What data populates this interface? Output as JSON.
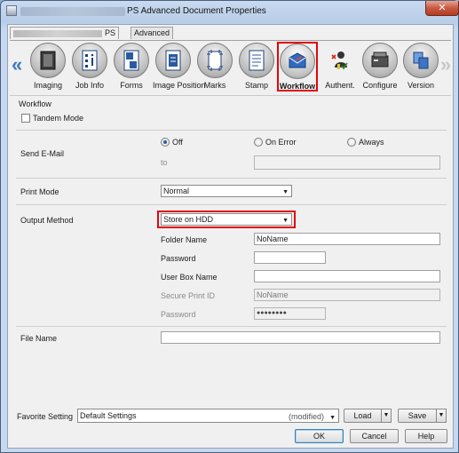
{
  "window": {
    "title": "PS Advanced Document Properties",
    "close_glyph": "✕"
  },
  "tabs": [
    {
      "label": "PS"
    },
    {
      "label": "Advanced"
    }
  ],
  "nav": {
    "left_arrow": "«",
    "right_arrow": "»",
    "items": [
      {
        "label": "Imaging",
        "icon": "imaging-icon"
      },
      {
        "label": "Job Info",
        "icon": "job-info-icon"
      },
      {
        "label": "Forms",
        "icon": "forms-icon"
      },
      {
        "label": "Image Position",
        "icon": "image-position-icon"
      },
      {
        "label": "Marks",
        "icon": "marks-icon"
      },
      {
        "label": "Stamp",
        "icon": "stamp-icon"
      },
      {
        "label": "Workflow",
        "icon": "workflow-icon",
        "selected": true
      },
      {
        "label": "Authent.",
        "icon": "authentication-icon"
      },
      {
        "label": "Configure",
        "icon": "configure-icon"
      },
      {
        "label": "Version",
        "icon": "version-icon"
      }
    ]
  },
  "workflow": {
    "section_title": "Workflow",
    "tandem_mode": {
      "label": "Tandem Mode",
      "checked": false
    },
    "send_email": {
      "label": "Send E-Mail",
      "options": [
        "Off",
        "On Error",
        "Always"
      ],
      "selected": "Off",
      "to_label": "to",
      "to_value": ""
    },
    "print_mode": {
      "label": "Print Mode",
      "value": "Normal"
    },
    "output_method": {
      "label": "Output Method",
      "value": "Store on HDD",
      "folder_name_label": "Folder Name",
      "folder_name_value": "NoName",
      "password_label": "Password",
      "password_value": "",
      "user_box_label": "User Box Name",
      "user_box_value": "",
      "secure_id_label": "Secure Print ID",
      "secure_id_value": "NoName",
      "secure_password_label": "Password",
      "secure_password_value": "●●●●●●●●"
    },
    "file_name": {
      "label": "File Name",
      "value": ""
    }
  },
  "favorite": {
    "label": "Favorite Setting",
    "value": "Default Settings",
    "modified": "(modified)",
    "load_label": "Load",
    "save_label": "Save"
  },
  "dialog_buttons": {
    "ok": "OK",
    "cancel": "Cancel",
    "help": "Help"
  },
  "colors": {
    "highlight": "#e1060b",
    "accent": "#3f79c0"
  }
}
